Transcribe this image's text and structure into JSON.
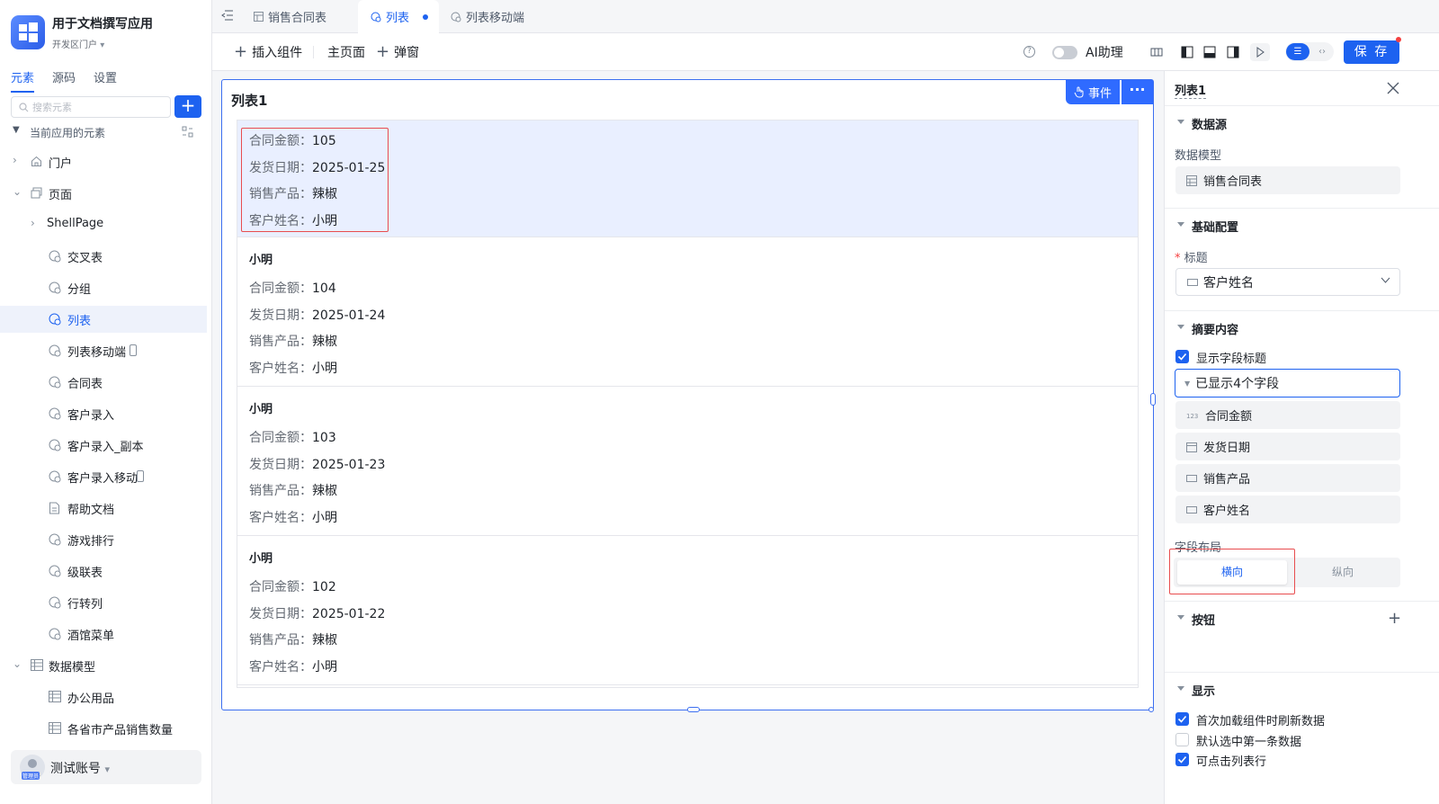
{
  "app": {
    "name": "用于文档撰写应用",
    "portal": "开发区门户"
  },
  "left_tabs": [
    {
      "label": "元素"
    },
    {
      "label": "源码"
    },
    {
      "label": "设置"
    }
  ],
  "search": {
    "placeholder": "搜索元素"
  },
  "tree": {
    "root": "当前应用的元素",
    "items": [
      {
        "label": "门户",
        "icon": "home-icon"
      },
      {
        "label": "页面",
        "icon": "page-icon"
      },
      {
        "label": "ShellPage",
        "icon": ""
      },
      {
        "label": "交叉表",
        "icon": "page-item-icon"
      },
      {
        "label": "分组",
        "icon": "page-item-icon"
      },
      {
        "label": "列表",
        "icon": "page-item-icon"
      },
      {
        "label": "列表移动端",
        "icon": "page-item-icon"
      },
      {
        "label": "合同表",
        "icon": "page-item-icon"
      },
      {
        "label": "客户录入",
        "icon": "page-item-icon"
      },
      {
        "label": "客户录入_副本",
        "icon": "page-item-icon"
      },
      {
        "label": "客户录入移动",
        "icon": "page-item-icon"
      },
      {
        "label": "帮助文档",
        "icon": "doc-icon"
      },
      {
        "label": "游戏排行",
        "icon": "page-item-icon"
      },
      {
        "label": "级联表",
        "icon": "page-item-icon"
      },
      {
        "label": "行转列",
        "icon": "page-item-icon"
      },
      {
        "label": "酒馆菜单",
        "icon": "page-item-icon"
      },
      {
        "label": "数据模型",
        "icon": "table-icon"
      },
      {
        "label": "办公用品",
        "icon": "table-icon"
      },
      {
        "label": "各省市产品销售数量",
        "icon": "table-icon"
      }
    ]
  },
  "user": {
    "name": "测试账号",
    "role": "管理员"
  },
  "tabs": [
    {
      "label": "销售合同表"
    },
    {
      "label": "列表"
    },
    {
      "label": "列表移动端"
    }
  ],
  "toolbar": {
    "insert": "插入组件",
    "home": "主页面",
    "popup": "弹窗",
    "ai": "AI助理",
    "save": "保 存"
  },
  "list": {
    "title": "列表1",
    "event_btn": "事件",
    "more": "···",
    "items": [
      {
        "title": "",
        "amount": "105",
        "date": "2025-01-25",
        "product": "辣椒",
        "customer": "小明"
      },
      {
        "title": "小明",
        "amount": "104",
        "date": "2025-01-24",
        "product": "辣椒",
        "customer": "小明"
      },
      {
        "title": "小明",
        "amount": "103",
        "date": "2025-01-23",
        "product": "辣椒",
        "customer": "小明"
      },
      {
        "title": "小明",
        "amount": "102",
        "date": "2025-01-22",
        "product": "辣椒",
        "customer": "小明"
      }
    ],
    "labels": {
      "amount": "合同金额：",
      "date": "发货日期：",
      "product": "销售产品：",
      "customer": "客户姓名："
    }
  },
  "panel": {
    "name": "列表1",
    "datasource": "数据源",
    "model_label": "数据模型",
    "model": "销售合同表",
    "basic": "基础配置",
    "title_label": "标题",
    "title_value": "客户姓名",
    "summary": "摘要内容",
    "show_titles": "显示字段标题",
    "shown_fields": "已显示4个字段",
    "fields": [
      {
        "label": "合同金额",
        "icon": "number-icon"
      },
      {
        "label": "发货日期",
        "icon": "date-icon"
      },
      {
        "label": "销售产品",
        "icon": "text-icon"
      },
      {
        "label": "客户姓名",
        "icon": "text-icon"
      }
    ],
    "layout_label": "字段布局",
    "layout_h": "横向",
    "layout_v": "纵向",
    "buttons": "按钮",
    "display": "显示",
    "opts": [
      {
        "label": "首次加载组件时刷新数据",
        "checked": true
      },
      {
        "label": "默认选中第一条数据",
        "checked": false
      },
      {
        "label": "可点击列表行",
        "checked": true
      }
    ]
  },
  "colors": {
    "accent": "#1d62f0",
    "highlight": "#e84d4f"
  }
}
